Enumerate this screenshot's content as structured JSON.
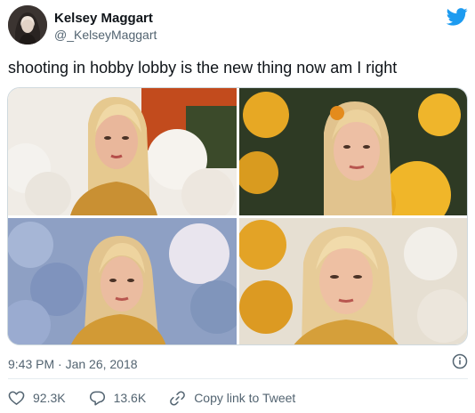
{
  "author": {
    "name": "Kelsey Maggart",
    "handle": "@_KelseyMaggart"
  },
  "tweet": {
    "text": "shooting in hobby lobby is the new thing now am I right",
    "timestamp": "9:43 PM · Jan 26, 2018"
  },
  "media": {
    "photo_count": 4
  },
  "actions": {
    "likes": "92.3K",
    "replies": "13.6K",
    "copy_link_label": "Copy link to Tweet"
  },
  "icons": {
    "logo": "twitter-bird-icon",
    "info": "info-icon",
    "like": "heart-icon",
    "reply": "reply-icon",
    "copy": "link-icon"
  },
  "colors": {
    "twitter_blue": "#1d9bf0",
    "secondary_text": "#536471",
    "divider": "#e6ecf0"
  }
}
